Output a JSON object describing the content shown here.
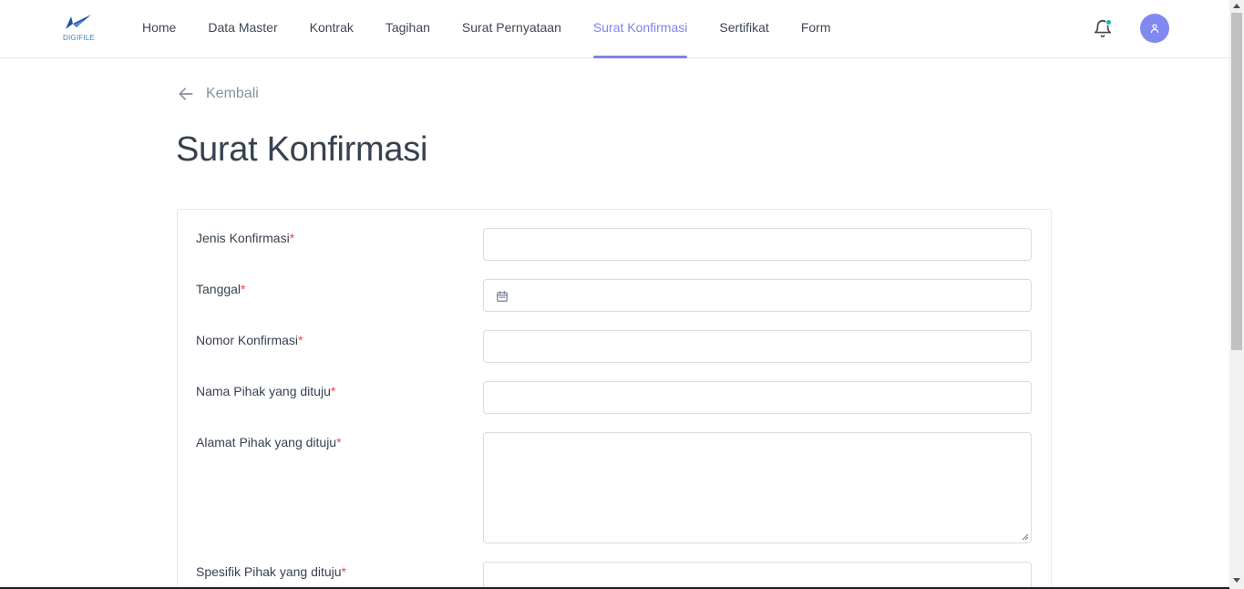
{
  "header": {
    "logo_text": "DIGIFILE",
    "nav": [
      {
        "label": "Home"
      },
      {
        "label": "Data Master"
      },
      {
        "label": "Kontrak"
      },
      {
        "label": "Tagihan"
      },
      {
        "label": "Surat Pernyataan"
      },
      {
        "label": "Surat Konfirmasi"
      },
      {
        "label": "Sertifikat"
      },
      {
        "label": "Form"
      }
    ],
    "active_nav": "Surat Konfirmasi",
    "icons": {
      "notification": "bell-icon",
      "profile": "user-icon"
    },
    "accent_color": "#7b83eb",
    "notification_dot_color": "#14b8a6"
  },
  "back": {
    "label": "Kembali",
    "icon": "arrow-left-icon"
  },
  "page": {
    "title": "Surat Konfirmasi"
  },
  "form": {
    "required_mark": "*",
    "fields": [
      {
        "label": "Jenis Konfirmasi",
        "value": ""
      },
      {
        "label": "Tanggal",
        "value": "",
        "icon": "calendar-icon"
      },
      {
        "label": "Nomor Konfirmasi",
        "value": ""
      },
      {
        "label": "Nama Pihak yang dituju",
        "value": ""
      },
      {
        "label": "Alamat Pihak yang dituju",
        "value": ""
      },
      {
        "label": "Spesifik Pihak yang dituju",
        "value": ""
      }
    ]
  }
}
